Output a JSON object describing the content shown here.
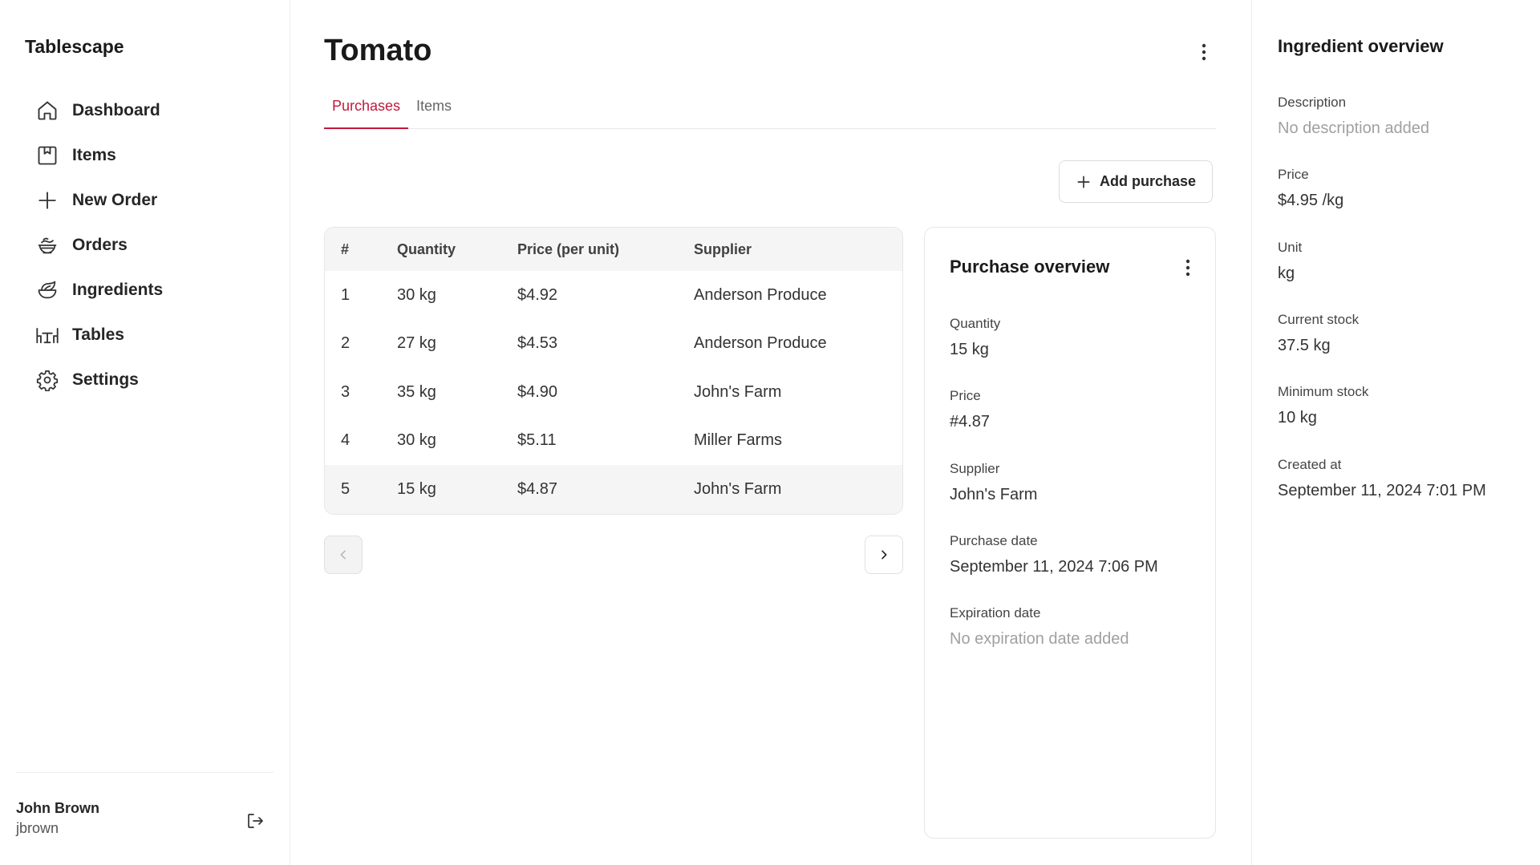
{
  "app": {
    "brand": "Tablescape"
  },
  "sidebar": {
    "items": [
      {
        "label": "Dashboard",
        "icon": "home-icon"
      },
      {
        "label": "Items",
        "icon": "bookmark-square-icon"
      },
      {
        "label": "New Order",
        "icon": "plus-icon"
      },
      {
        "label": "Orders",
        "icon": "bowl-icon"
      },
      {
        "label": "Ingredients",
        "icon": "leaf-bowl-icon"
      },
      {
        "label": "Tables",
        "icon": "table-chairs-icon"
      },
      {
        "label": "Settings",
        "icon": "gear-icon"
      }
    ],
    "user": {
      "name": "John Brown",
      "handle": "jbrown"
    }
  },
  "main": {
    "title": "Tomato",
    "tabs": [
      {
        "label": "Purchases",
        "active": true
      },
      {
        "label": "Items",
        "active": false
      }
    ],
    "add_purchase_label": "Add purchase",
    "table": {
      "headers": [
        "#",
        "Quantity",
        "Price (per unit)",
        "Supplier"
      ],
      "rows": [
        [
          "1",
          "30 kg",
          "$4.92",
          "Anderson Produce"
        ],
        [
          "2",
          "27 kg",
          "$4.53",
          "Anderson Produce"
        ],
        [
          "3",
          "35 kg",
          "$4.90",
          "John's Farm"
        ],
        [
          "4",
          "30 kg",
          "$5.11",
          "Miller Farms"
        ],
        [
          "5",
          "15 kg",
          "$4.87",
          "John's Farm"
        ]
      ],
      "selected_row": 5
    }
  },
  "purchase_overview": {
    "title": "Purchase overview",
    "fields": [
      {
        "label": "Quantity",
        "value": "15 kg"
      },
      {
        "label": "Price",
        "value": "#4.87"
      },
      {
        "label": "Supplier",
        "value": "John's Farm"
      },
      {
        "label": "Purchase date",
        "value": "September 11, 2024 7:06 PM"
      },
      {
        "label": "Expiration date",
        "value": "No expiration date added"
      }
    ]
  },
  "ingredient_overview": {
    "title": "Ingredient overview",
    "fields": [
      {
        "label": "Description",
        "value": "No description added"
      },
      {
        "label": "Price",
        "value": "$4.95 /kg"
      },
      {
        "label": "Unit",
        "value": "kg"
      },
      {
        "label": "Current stock",
        "value": "37.5 kg"
      },
      {
        "label": "Minimum stock",
        "value": "10 kg"
      },
      {
        "label": "Created at",
        "value": "September 11, 2024 7:01 PM"
      }
    ]
  },
  "colors": {
    "accent": "#c0183b",
    "border": "#e6e6e6",
    "muted_text": "#a0a0a0"
  }
}
